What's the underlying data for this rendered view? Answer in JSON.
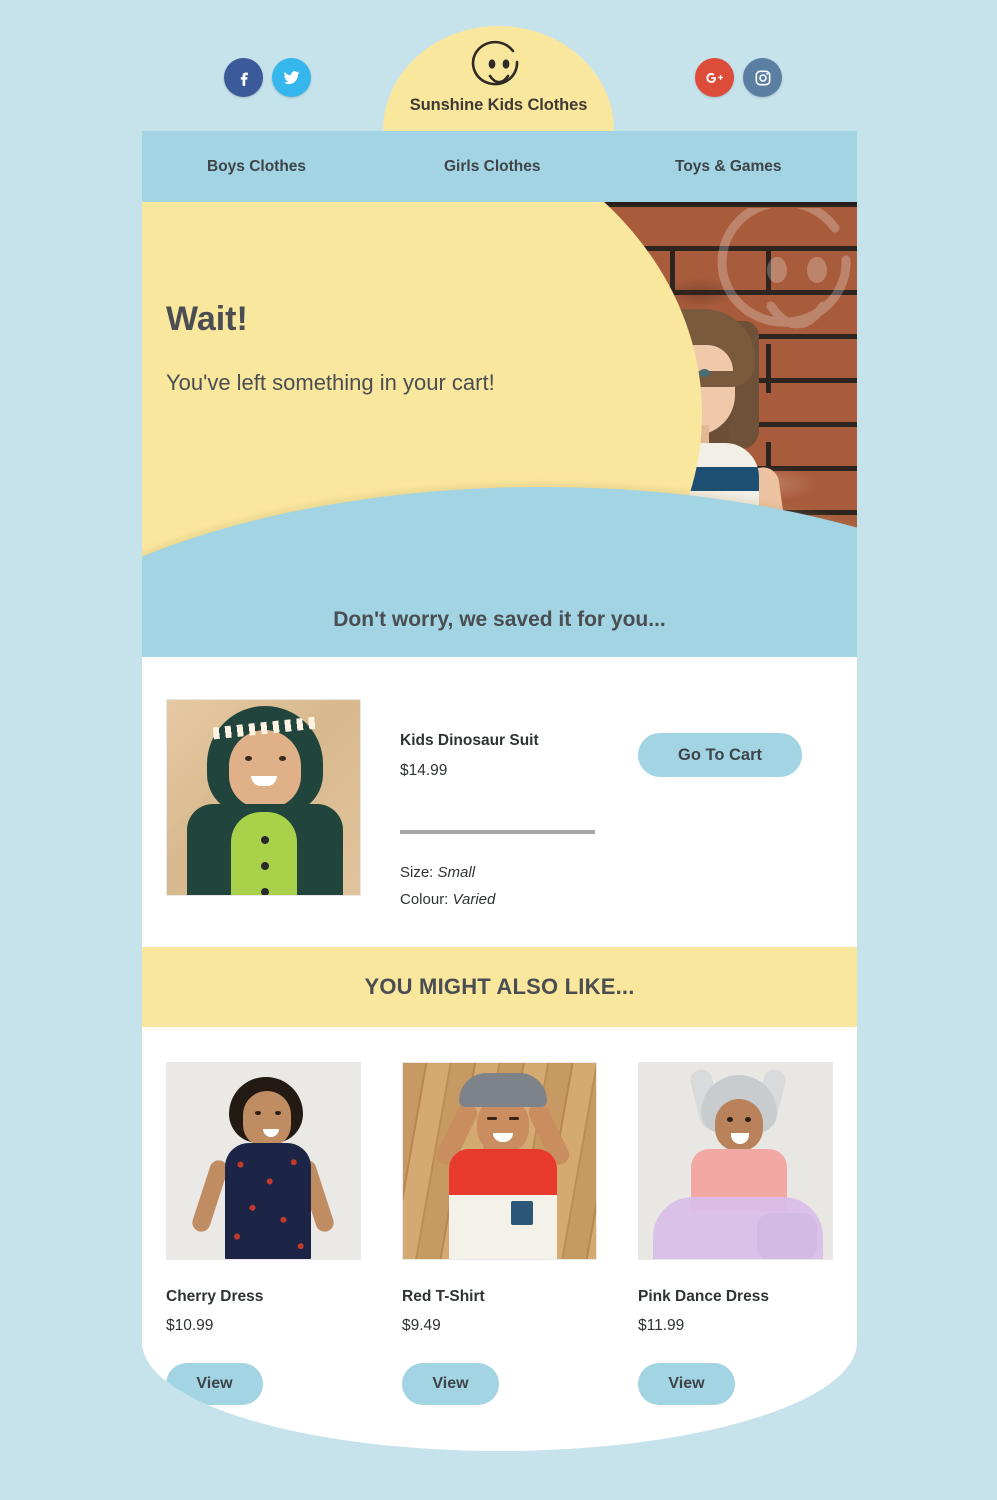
{
  "brand": {
    "name": "Sunshine Kids Clothes",
    "logo_icon": "smiley-face-icon",
    "dome_color": "#fae79e"
  },
  "colors": {
    "page_background": "#c6e2eb",
    "card_background": "#ffffff",
    "accent_blue": "#a2d4e3",
    "accent_yellow": "#fae79e",
    "text_dark": "#4a4e52"
  },
  "social": {
    "left": [
      {
        "name": "facebook",
        "icon": "facebook-icon",
        "color": "#3b5a9a"
      },
      {
        "name": "twitter",
        "icon": "twitter-icon",
        "color": "#35b6ec"
      }
    ],
    "right": [
      {
        "name": "google-plus",
        "icon": "google-plus-icon",
        "color": "#dd4b39"
      },
      {
        "name": "instagram",
        "icon": "instagram-icon",
        "color": "#5b7fa3"
      }
    ]
  },
  "nav": {
    "items": [
      {
        "label": "Boys Clothes"
      },
      {
        "label": "Girls Clothes"
      },
      {
        "label": "Toys & Games"
      }
    ]
  },
  "hero": {
    "title": "Wait!",
    "subtitle": "You've left something in your cart!",
    "banner": "Don't worry, we saved it for you...",
    "photo_alt": "girl-in-striped-dress-against-brick-wall",
    "watermark_icon": "smiley-face-watermark-icon"
  },
  "cart": {
    "item": {
      "name": "Kids Dinosaur Suit",
      "price": "$14.99",
      "photo_alt": "child-in-green-dinosaur-onesie",
      "size_label": "Size:",
      "size_value": "Small",
      "colour_label": "Colour:",
      "colour_value": "Varied"
    },
    "cta_label": "Go To Cart"
  },
  "recommendations": {
    "heading": "YOU MIGHT ALSO LIKE...",
    "view_label": "View",
    "items": [
      {
        "name": "Cherry Dress",
        "price": "$10.99",
        "button": "View",
        "photo_alt": "girl-in-navy-cherry-print-dress"
      },
      {
        "name": "Red T-Shirt",
        "price": "$9.49",
        "button": "View",
        "photo_alt": "boy-in-red-and-white-tshirt"
      },
      {
        "name": "Pink Dance Dress",
        "price": "$11.99",
        "button": "View",
        "photo_alt": "girl-in-pink-top-and-lavender-tutu"
      }
    ]
  }
}
